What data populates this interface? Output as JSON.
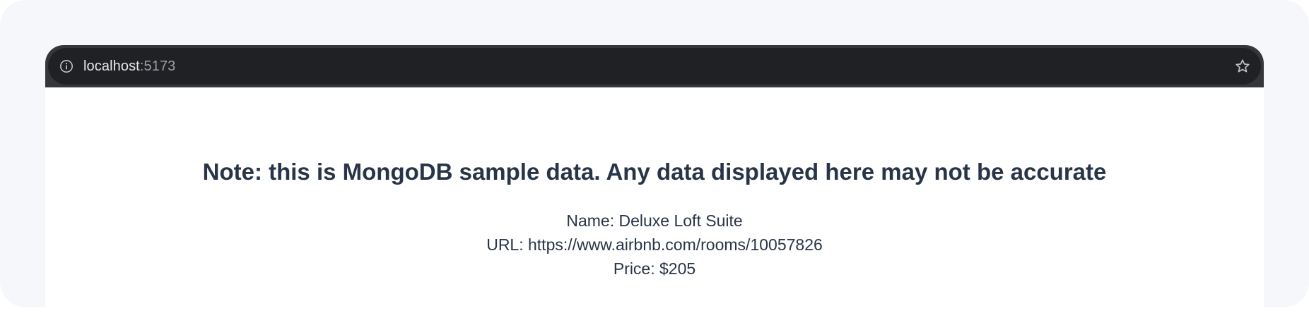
{
  "browser": {
    "url_host": "localhost",
    "url_port": ":5173"
  },
  "page": {
    "note": "Note: this is MongoDB sample data. Any data displayed here may not be accurate",
    "listing": {
      "name_label": "Name: ",
      "name": "Deluxe Loft Suite",
      "url_label": "URL: ",
      "url": "https://www.airbnb.com/rooms/10057826",
      "price_label": "Price: ",
      "price": "$205"
    }
  },
  "colors": {
    "toolbar": "#35363a",
    "omnibox": "#202124",
    "text_primary": "#283447",
    "outer_background": "#f6f7fb"
  },
  "icons": [
    "info-icon",
    "star-icon"
  ]
}
